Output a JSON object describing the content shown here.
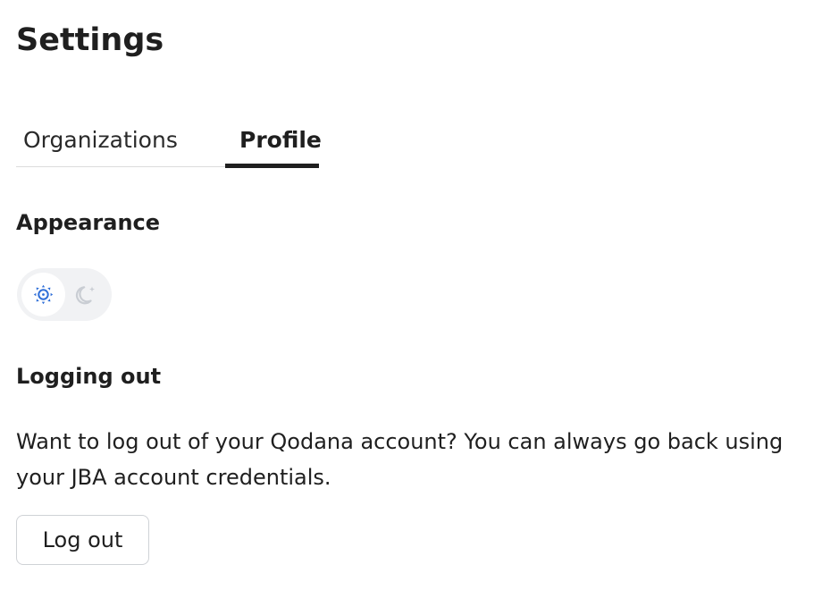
{
  "page": {
    "title": "Settings"
  },
  "tabs": [
    {
      "label": "Organizations",
      "active": false
    },
    {
      "label": "Profile",
      "active": true
    }
  ],
  "appearance": {
    "title": "Appearance",
    "options": [
      {
        "icon": "sun-icon",
        "selected": true
      },
      {
        "icon": "moon-icon",
        "selected": false
      }
    ]
  },
  "logout": {
    "title": "Logging out",
    "description": "Want to log out of your Qodana account? You can always go back using your JBA account credentials.",
    "button_label": "Log out"
  },
  "colors": {
    "text": "#1f1f1f",
    "accent_icon": "#2f6fd8",
    "muted_icon": "#c9cdd3",
    "toggle_background": "#f1f2f4",
    "button_border": "#cfd2d6"
  }
}
